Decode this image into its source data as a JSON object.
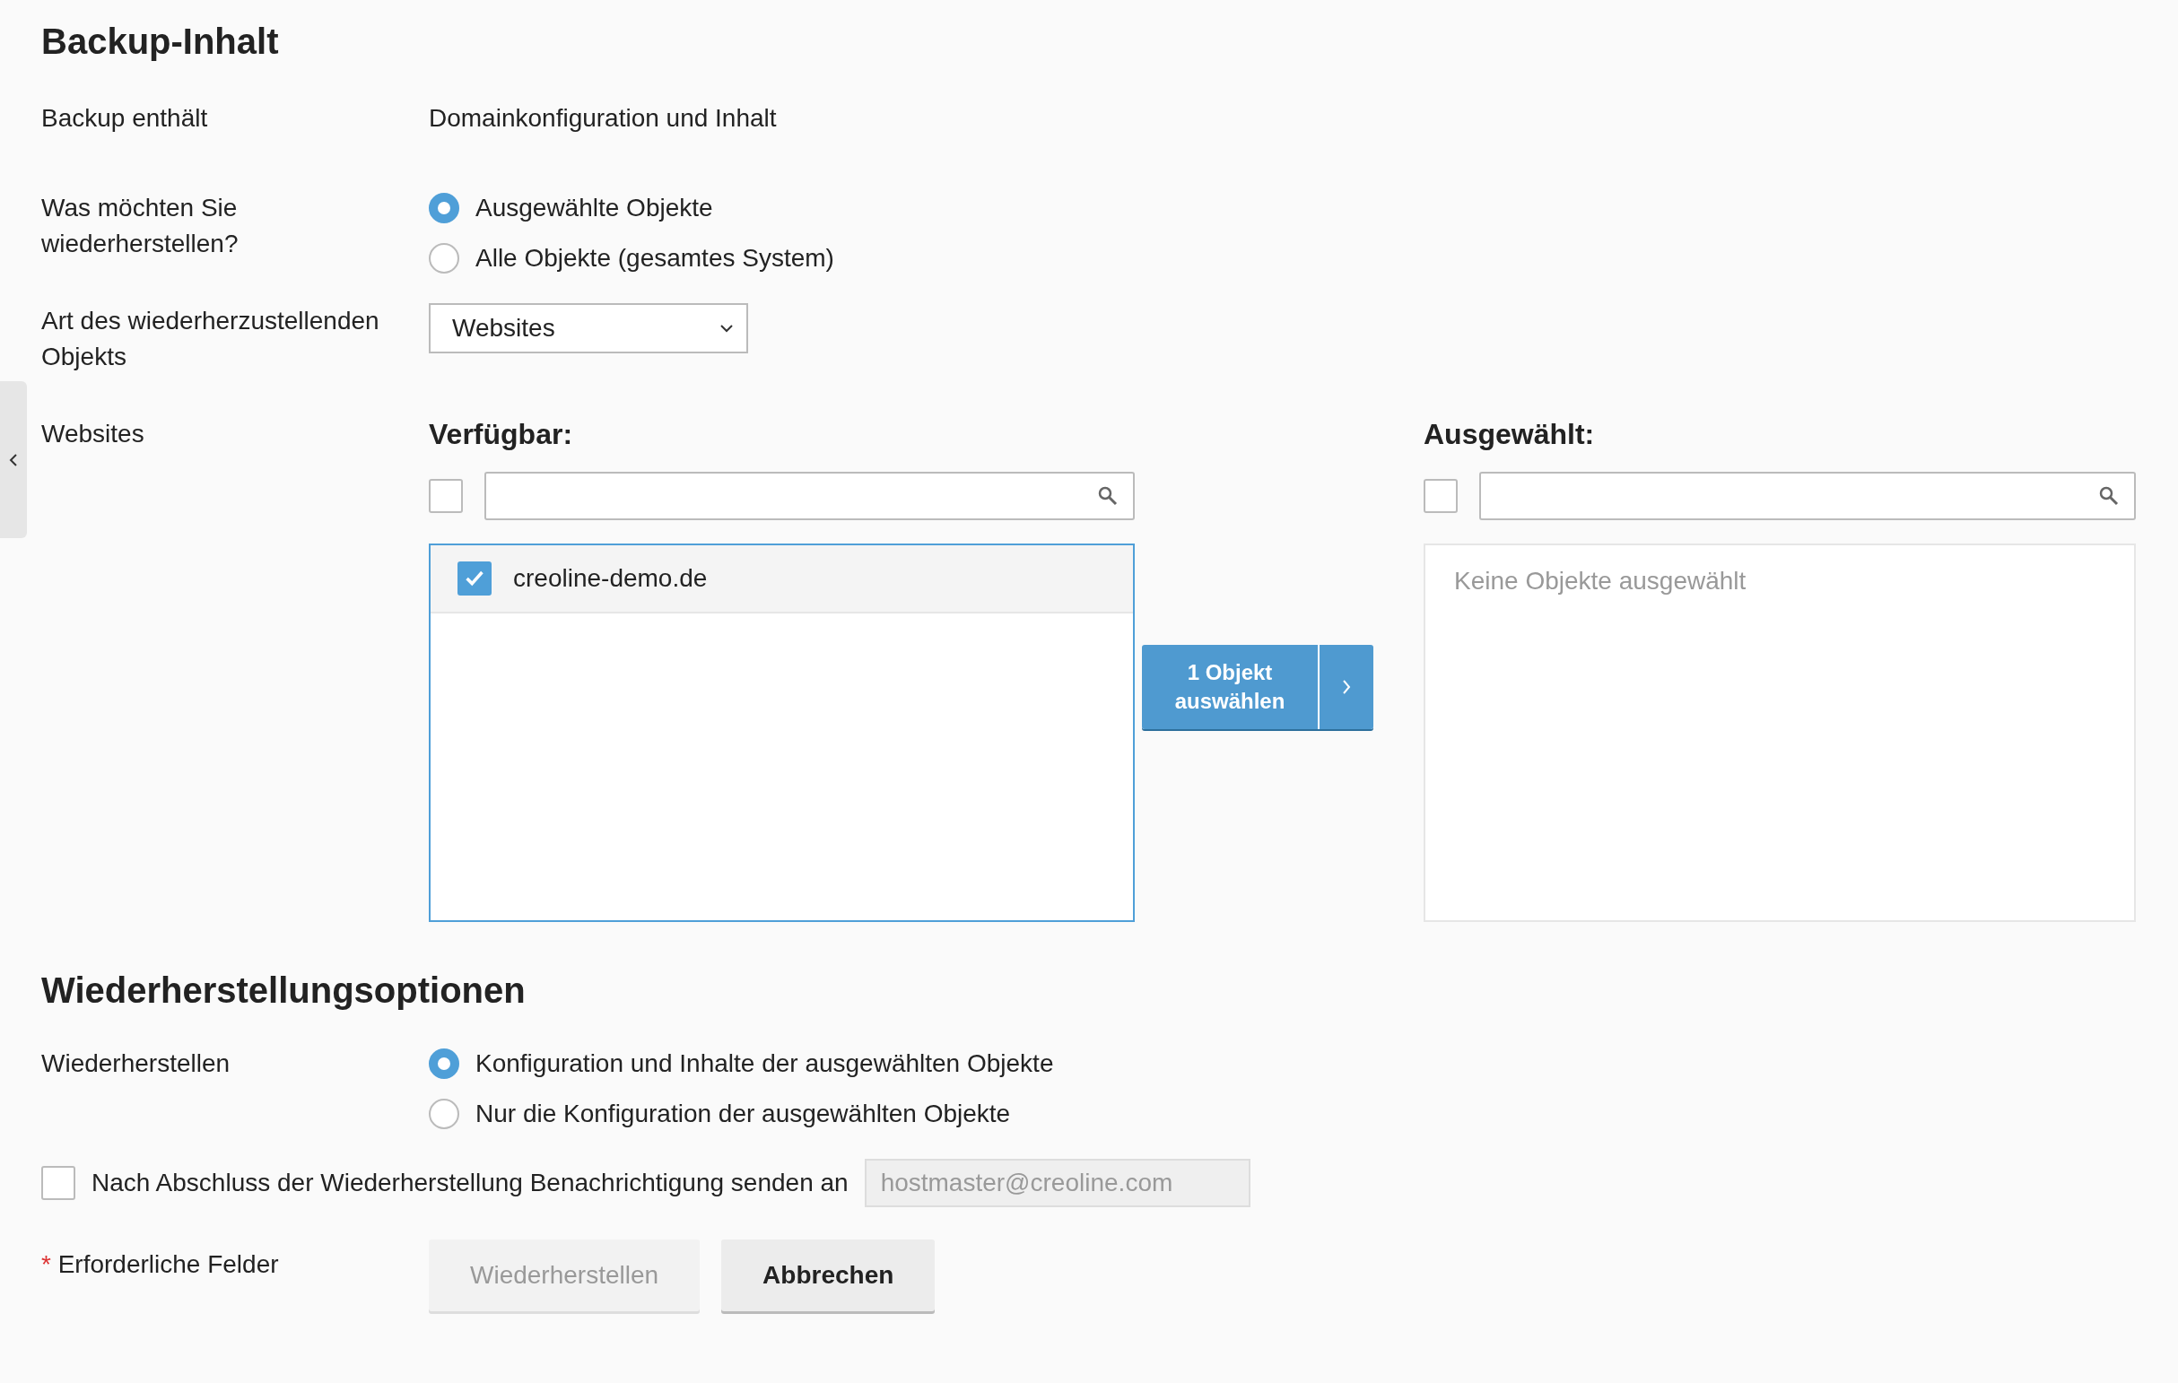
{
  "backup_content": {
    "title": "Backup-Inhalt",
    "contains": {
      "label": "Backup enthält",
      "value": "Domainkonfiguration und Inhalt"
    },
    "what": {
      "label": "Was möchten Sie wiederherstellen?",
      "options": [
        {
          "label": "Ausgewählte Objekte",
          "selected": true
        },
        {
          "label": "Alle Objekte (gesamtes System)",
          "selected": false
        }
      ]
    },
    "type": {
      "label": "Art des wiederherzustellenden Objekts",
      "value": "Websites"
    },
    "picker": {
      "label": "Websites",
      "available": {
        "title": "Verfügbar:",
        "select_all_checked": false,
        "items": [
          {
            "label": "creoline-demo.de",
            "checked": true
          }
        ]
      },
      "move_button": {
        "label": "1 Objekt auswählen"
      },
      "chosen": {
        "title": "Ausgewählt:",
        "select_all_checked": false,
        "empty_text": "Keine Objekte ausgewählt"
      }
    }
  },
  "restore_options": {
    "title": "Wiederherstellungsoptionen",
    "restore": {
      "label": "Wiederherstellen",
      "options": [
        {
          "label": "Konfiguration und Inhalte der ausgewählten Objekte",
          "selected": true
        },
        {
          "label": "Nur die Konfiguration der ausgewählten Objekte",
          "selected": false
        }
      ]
    },
    "notify": {
      "label": "Nach Abschluss der Wiederherstellung Benachrichtigung senden an",
      "checked": false,
      "email": {
        "value": "hostmaster@creoline.com",
        "disabled": true
      }
    }
  },
  "footer": {
    "required_mark": "*",
    "required_note": "Erforderliche Felder",
    "buttons": [
      {
        "label": "Wiederherstellen",
        "disabled": true
      },
      {
        "label": "Abbrechen",
        "disabled": false
      }
    ]
  }
}
